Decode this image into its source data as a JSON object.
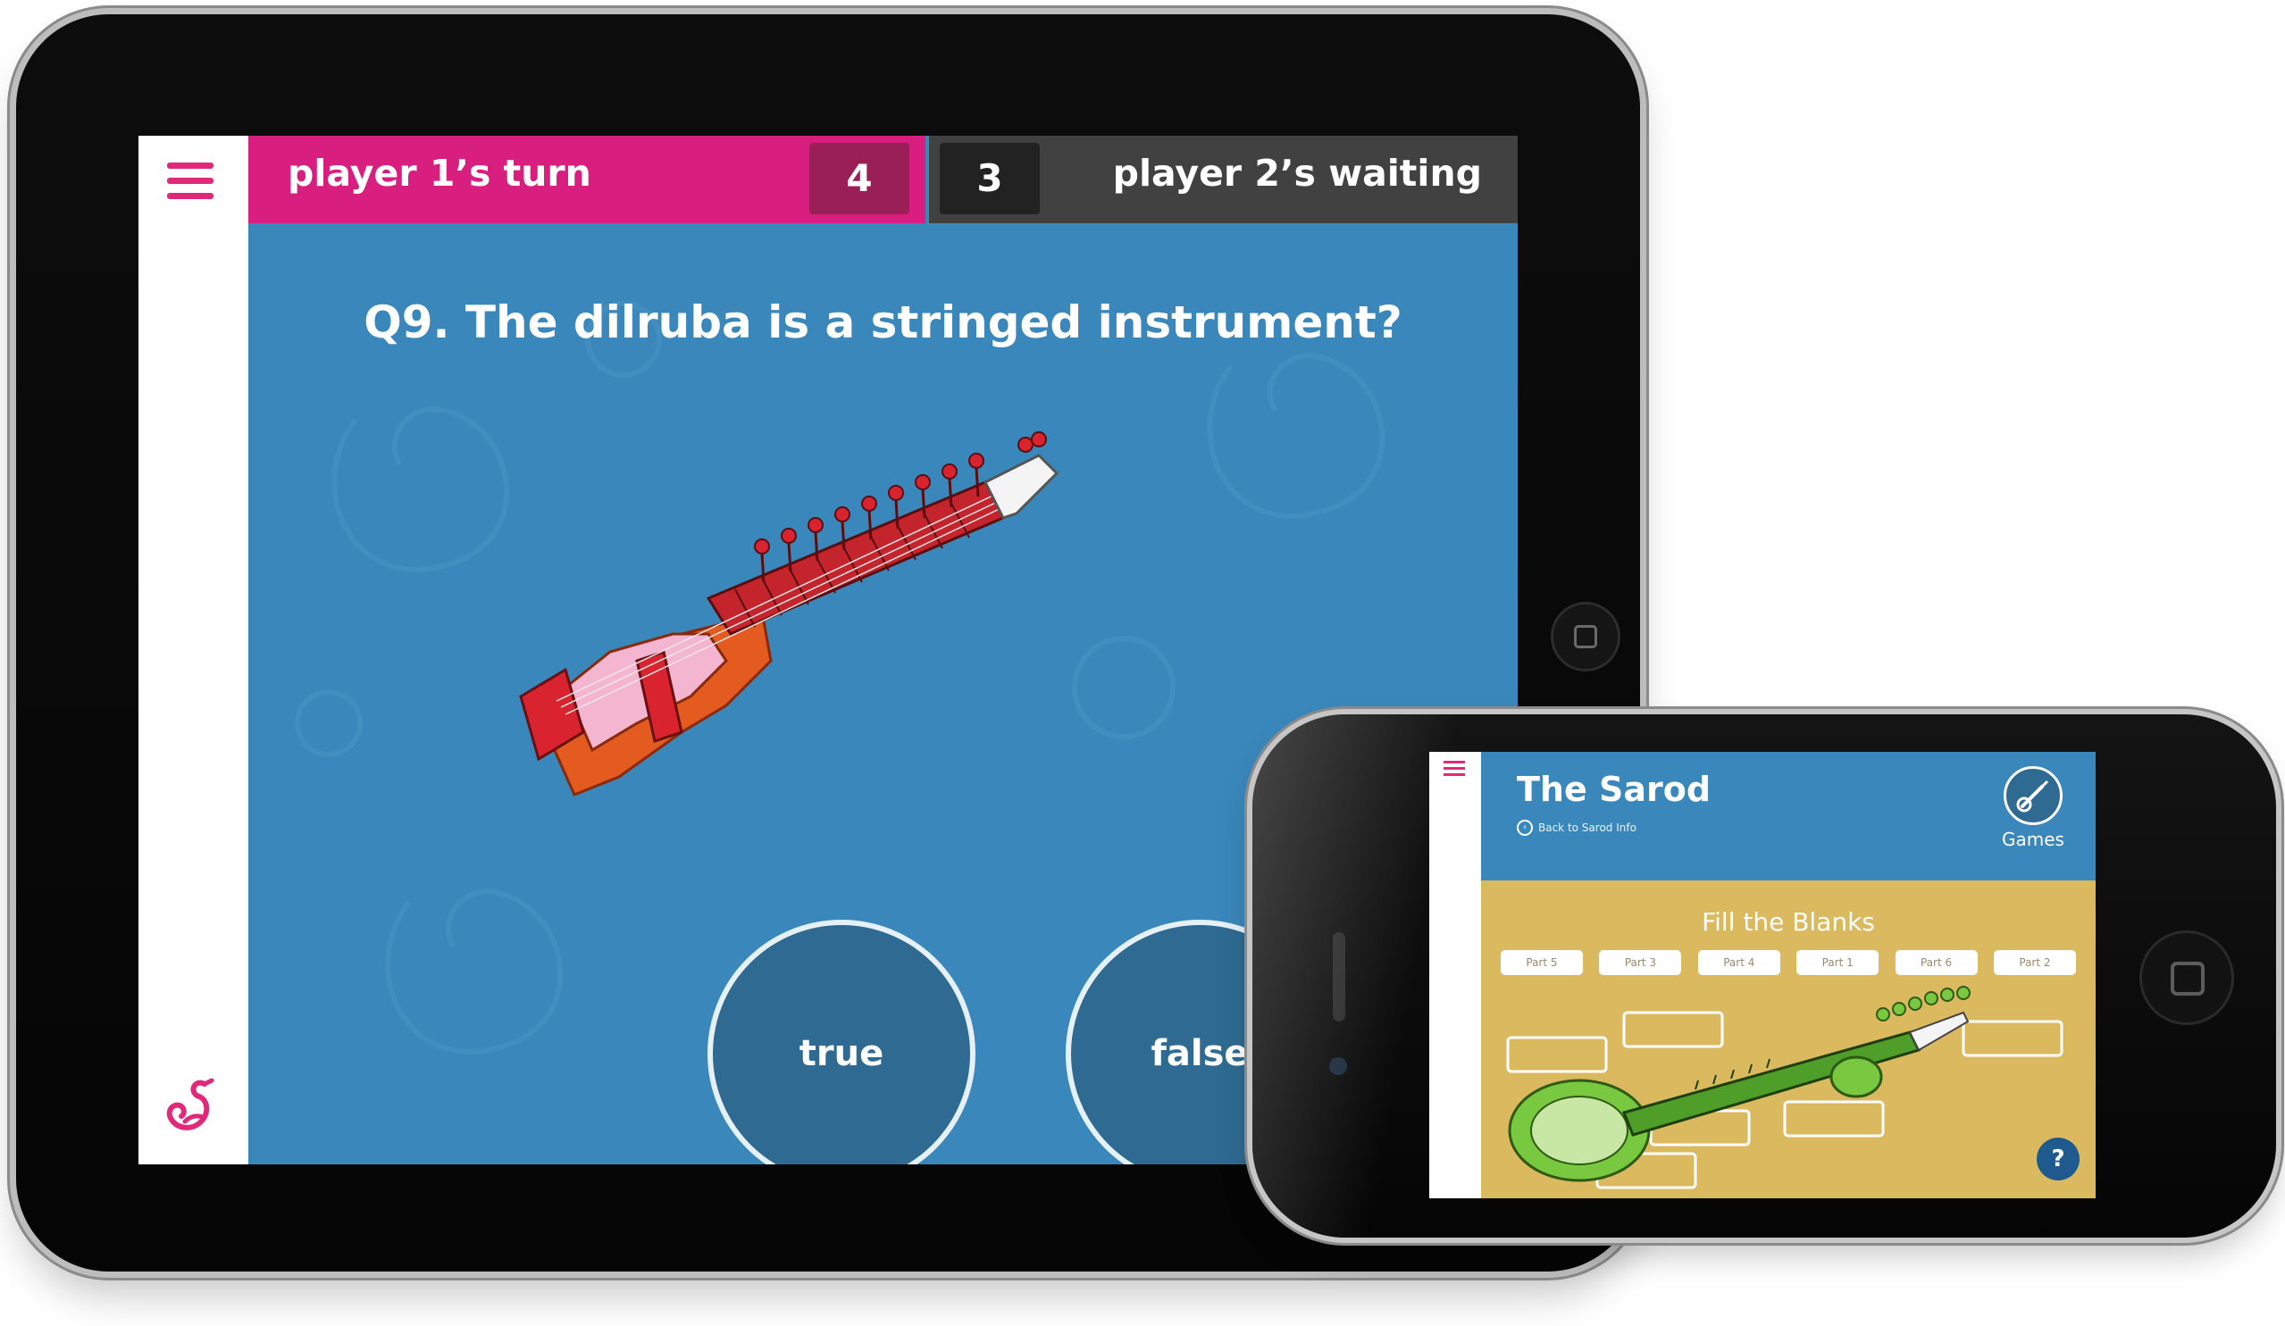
{
  "tablet": {
    "menu_icon": "hamburger-menu-icon",
    "logo_icon": "swan-logo-icon",
    "player1": {
      "label": "player 1’s turn",
      "score": "4",
      "color": "#d81f7f"
    },
    "player2": {
      "label": "player 2’s waiting",
      "score": "3",
      "color": "#414141"
    },
    "question": "Q9. The dilruba is a stringed instrument?",
    "illustration": "dilruba-instrument",
    "answers": {
      "true_label": "true",
      "false_label": "false"
    },
    "background_color": "#3a87bb"
  },
  "phone": {
    "menu_icon": "hamburger-menu-icon",
    "title": "The Sarod",
    "back_link": "Back to Sarod Info",
    "games_label": "Games",
    "game_title": "Fill the Blanks",
    "parts": [
      "Part 5",
      "Part 3",
      "Part 4",
      "Part 1",
      "Part 6",
      "Part 2"
    ],
    "illustration": "sarod-instrument",
    "help_label": "?",
    "game_background_color": "#dab95f"
  }
}
